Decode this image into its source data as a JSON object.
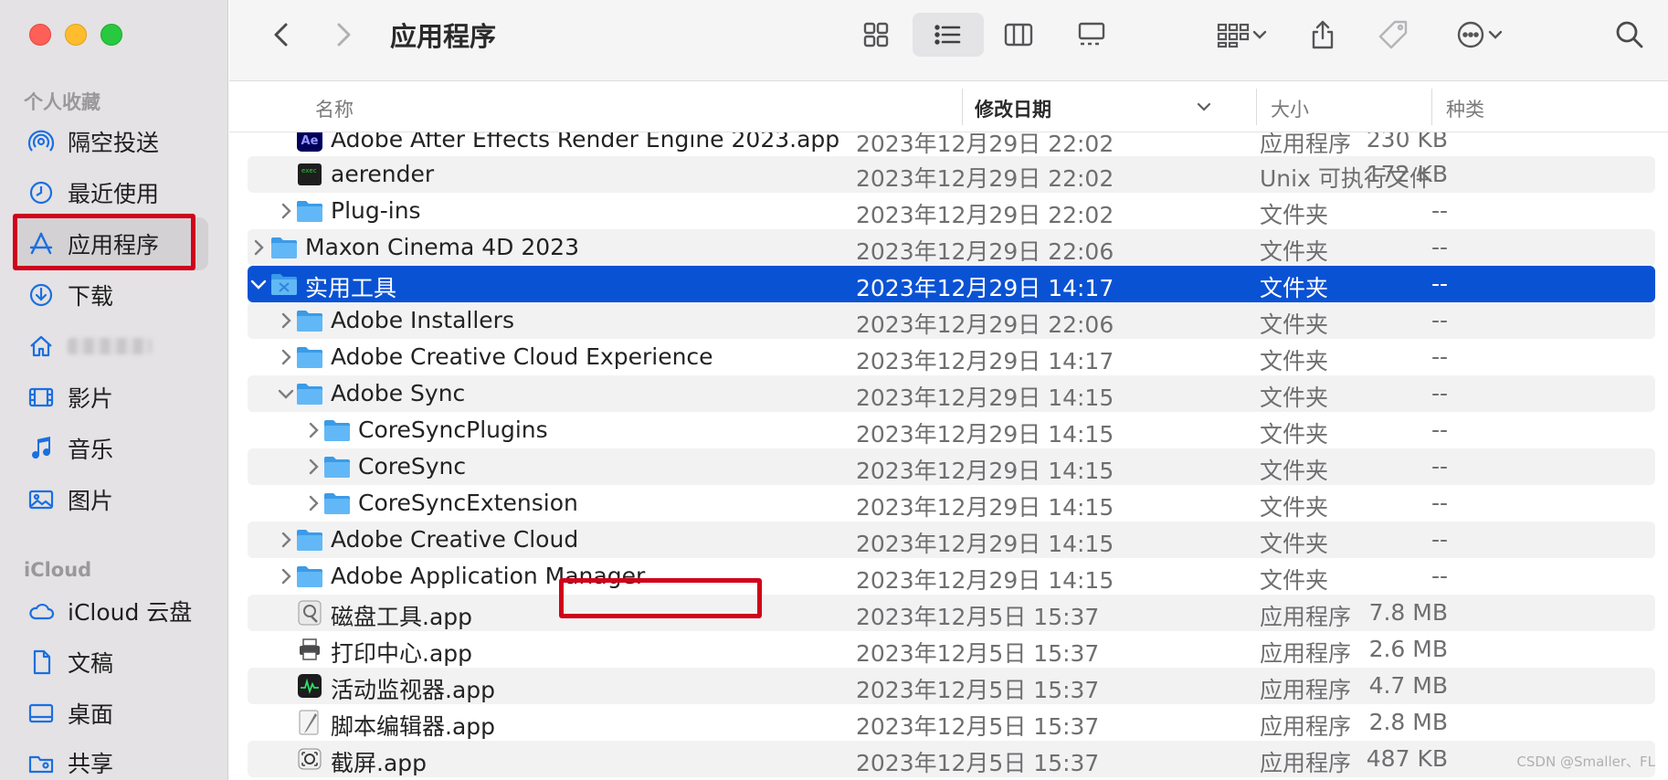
{
  "window": {
    "title": "应用程序"
  },
  "sidebar": {
    "sections": [
      {
        "label": "个人收藏"
      },
      {
        "label": "iCloud"
      }
    ],
    "items": [
      {
        "label": "隔空投送",
        "icon": "airdrop-icon"
      },
      {
        "label": "最近使用",
        "icon": "clock-icon"
      },
      {
        "label": "应用程序",
        "icon": "applications-icon"
      },
      {
        "label": "下载",
        "icon": "download-icon"
      },
      {
        "label": "",
        "icon": "home-icon"
      },
      {
        "label": "影片",
        "icon": "film-icon"
      },
      {
        "label": "音乐",
        "icon": "music-icon"
      },
      {
        "label": "图片",
        "icon": "photo-icon"
      },
      {
        "label": "iCloud 云盘",
        "icon": "cloud-icon"
      },
      {
        "label": "文稿",
        "icon": "document-icon"
      },
      {
        "label": "桌面",
        "icon": "desktop-icon"
      },
      {
        "label": "共享",
        "icon": "shared-folder-icon"
      }
    ]
  },
  "columns": {
    "name": "名称",
    "date": "修改日期",
    "size": "大小",
    "kind": "种类"
  },
  "rows": [
    {
      "name": "Adobe After Effects Render Engine 2023.app",
      "date": "2023年12月29日 22:02",
      "size": "230 KB",
      "kind": "应用程序",
      "icon": "ae-app-icon"
    },
    {
      "name": "aerender",
      "date": "2023年12月29日 22:02",
      "size": "172 KB",
      "kind": "Unix 可执行文件",
      "icon": "terminal-exec-icon"
    },
    {
      "name": "Plug-ins",
      "date": "2023年12月29日 22:02",
      "size": "--",
      "kind": "文件夹",
      "icon": "folder-icon"
    },
    {
      "name": "Maxon Cinema 4D 2023",
      "date": "2023年12月29日 22:06",
      "size": "--",
      "kind": "文件夹",
      "icon": "folder-icon"
    },
    {
      "name": "实用工具",
      "date": "2023年12月29日 14:17",
      "size": "--",
      "kind": "文件夹",
      "icon": "utilities-folder-icon"
    },
    {
      "name": "Adobe Installers",
      "date": "2023年12月29日 22:06",
      "size": "--",
      "kind": "文件夹",
      "icon": "folder-icon"
    },
    {
      "name": "Adobe Creative Cloud Experience",
      "date": "2023年12月29日 14:17",
      "size": "--",
      "kind": "文件夹",
      "icon": "folder-icon"
    },
    {
      "name": "Adobe Sync",
      "date": "2023年12月29日 14:15",
      "size": "--",
      "kind": "文件夹",
      "icon": "folder-icon"
    },
    {
      "name": "CoreSyncPlugins",
      "date": "2023年12月29日 14:15",
      "size": "--",
      "kind": "文件夹",
      "icon": "folder-icon"
    },
    {
      "name": "CoreSync",
      "date": "2023年12月29日 14:15",
      "size": "--",
      "kind": "文件夹",
      "icon": "folder-icon"
    },
    {
      "name": "CoreSyncExtension",
      "date": "2023年12月29日 14:15",
      "size": "--",
      "kind": "文件夹",
      "icon": "folder-icon"
    },
    {
      "name": "Adobe Creative Cloud",
      "date": "2023年12月29日 14:15",
      "size": "--",
      "kind": "文件夹",
      "icon": "folder-icon"
    },
    {
      "name": "Adobe Application Manager",
      "date": "2023年12月29日 14:15",
      "size": "--",
      "kind": "文件夹",
      "icon": "folder-icon"
    },
    {
      "name": "磁盘工具.app",
      "date": "2023年12月5日 15:37",
      "size": "7.8 MB",
      "kind": "应用程序",
      "icon": "disk-utility-icon"
    },
    {
      "name": "打印中心.app",
      "date": "2023年12月5日 15:37",
      "size": "2.6 MB",
      "kind": "应用程序",
      "icon": "printer-icon"
    },
    {
      "name": "活动监视器.app",
      "date": "2023年12月5日 15:37",
      "size": "4.7 MB",
      "kind": "应用程序",
      "icon": "activity-monitor-icon"
    },
    {
      "name": "脚本编辑器.app",
      "date": "2023年12月5日 15:37",
      "size": "2.8 MB",
      "kind": "应用程序",
      "icon": "script-editor-icon"
    },
    {
      "name": "截屏.app",
      "date": "2023年12月5日 15:37",
      "size": "487 KB",
      "kind": "应用程序",
      "icon": "screenshot-icon"
    }
  ],
  "watermark": "CSDN @Smaller、FL",
  "colors": {
    "selection": "#0a52d4",
    "highlight_box": "#d0021b",
    "folder": "#5ab4f4"
  }
}
